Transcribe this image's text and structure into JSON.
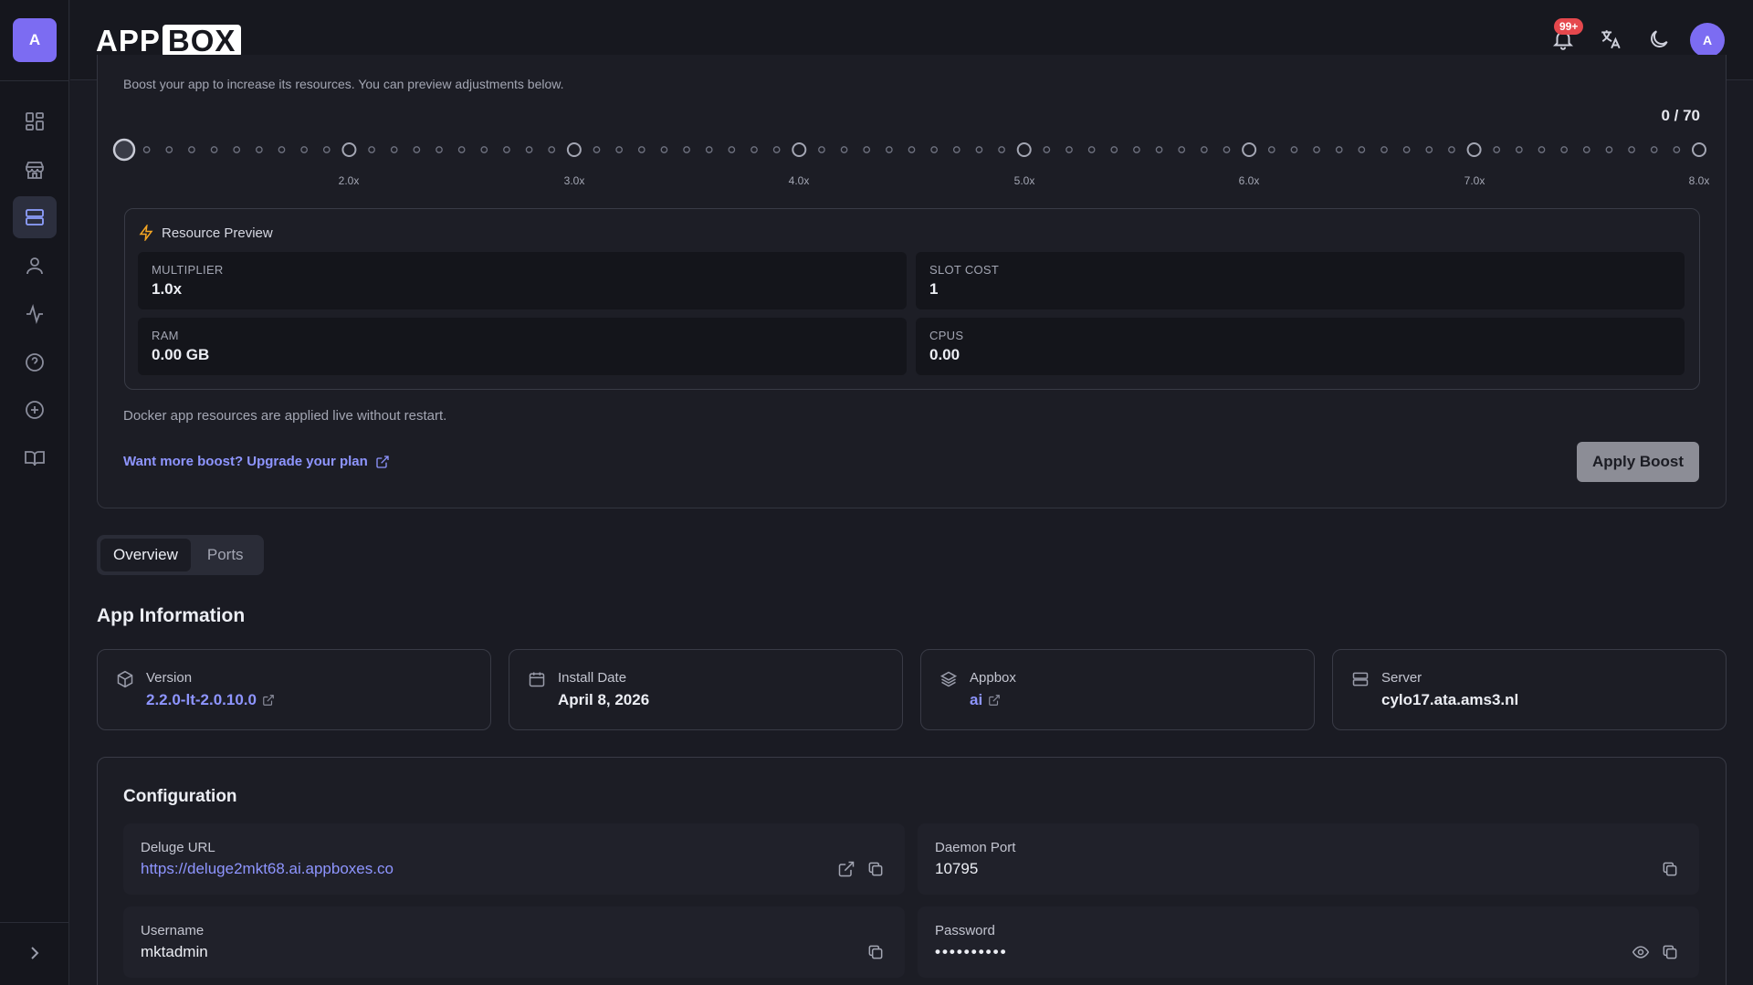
{
  "sidebar": {
    "avatar_letter": "A",
    "items": [
      {
        "name": "dashboard",
        "icon": "grid-icon"
      },
      {
        "name": "store",
        "icon": "store-icon"
      },
      {
        "name": "apps",
        "icon": "server-icon",
        "active": true
      },
      {
        "name": "account",
        "icon": "user-icon"
      },
      {
        "name": "activity",
        "icon": "activity-icon"
      },
      {
        "name": "help",
        "icon": "help-circle-icon"
      },
      {
        "name": "add",
        "icon": "plus-circle-icon"
      },
      {
        "name": "docs",
        "icon": "book-icon"
      }
    ]
  },
  "header": {
    "brand_left": "APP",
    "brand_right": "BOX",
    "notification_badge": "99+",
    "avatar_letter": "A"
  },
  "boost": {
    "intro": "Boost your app to increase its resources. You can preview adjustments below.",
    "count": "0 / 70",
    "slider_value": 0,
    "slider_max": 70,
    "tick_labels": [
      "2.0x",
      "3.0x",
      "4.0x",
      "5.0x",
      "6.0x",
      "7.0x",
      "8.0x"
    ],
    "preview_title": "Resource Preview",
    "multiplier_label": "MULTIPLIER",
    "multiplier_value": "1.0x",
    "slot_cost_label": "SLOT COST",
    "slot_cost_value": "1",
    "ram_label": "RAM",
    "ram_value": "0.00 GB",
    "cpus_label": "CPUS",
    "cpus_value": "0.00",
    "note": "Docker app resources are applied live without restart.",
    "upgrade_link": "Want more boost? Upgrade your plan",
    "apply_button": "Apply Boost"
  },
  "tabs": [
    "Overview",
    "Ports"
  ],
  "app_info": {
    "title": "App Information",
    "version_label": "Version",
    "version_value": "2.2.0-lt-2.0.10.0",
    "install_label": "Install Date",
    "install_value": "April 8, 2026",
    "appbox_label": "Appbox",
    "appbox_value": "ai",
    "server_label": "Server",
    "server_value": "cylo17.ata.ams3.nl"
  },
  "config": {
    "title": "Configuration",
    "deluge_url_label": "Deluge URL",
    "deluge_url_value": "https://deluge2mkt68.ai.appboxes.co",
    "daemon_port_label": "Daemon Port",
    "daemon_port_value": "10795",
    "username_label": "Username",
    "username_value": "mktadmin",
    "password_label": "Password",
    "password_value": "••••••••••"
  },
  "colors": {
    "accent": "#7c6cf2",
    "link": "#8e95ff",
    "badge": "#e5484d",
    "bolt": "#f5a623"
  }
}
